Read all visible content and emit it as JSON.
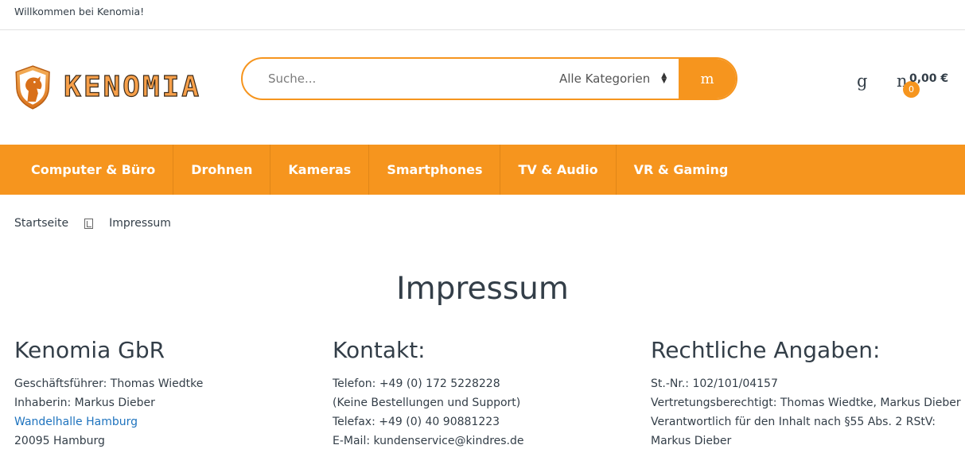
{
  "topbar": {
    "welcome": "Willkommen bei Kenomia!"
  },
  "logo": {
    "text": "KENOMIA"
  },
  "search": {
    "placeholder": "Suche...",
    "category": "Alle Kategorien",
    "button_icon": "m"
  },
  "header": {
    "account_icon": "g",
    "cart_icon": "n",
    "cart_count": "0",
    "cart_total": "0,00 €"
  },
  "nav": {
    "items": [
      {
        "label": "Computer & Büro"
      },
      {
        "label": "Drohnen"
      },
      {
        "label": "Kameras"
      },
      {
        "label": "Smartphones"
      },
      {
        "label": "TV & Audio"
      },
      {
        "label": "VR & Gaming"
      }
    ]
  },
  "breadcrumb": {
    "home": "Startseite",
    "current": "Impressum"
  },
  "page": {
    "title": "Impressum"
  },
  "columns": {
    "company": {
      "heading": "Kenomia GbR",
      "managing_director": "Geschäftsführer: Thomas Wiedtke",
      "owner": "Inhaberin: Markus Dieber",
      "address_link": "Wandelhalle Hamburg",
      "city": "20095 Hamburg"
    },
    "contact": {
      "heading": "Kontakt:",
      "phone": "Telefon: +49 (0) 172 5228228",
      "phone_note": "(Keine Bestellungen und Support)",
      "fax": "Telefax: +49 (0) 40 90881223",
      "email": "E-Mail: kundenservice@kindres.de"
    },
    "legal": {
      "heading": "Rechtliche Angaben:",
      "tax": "St.-Nr.: 102/101/04157",
      "representatives": "Vertretungsberechtigt: Thomas Wiedtke, Markus Dieber",
      "responsible_label": "Verantwortlich für den Inhalt nach §55 Abs. 2 RStV:",
      "responsible_name": "Markus Dieber"
    }
  },
  "colors": {
    "accent": "#f6951e",
    "text": "#333e48",
    "link": "#1e73be"
  }
}
